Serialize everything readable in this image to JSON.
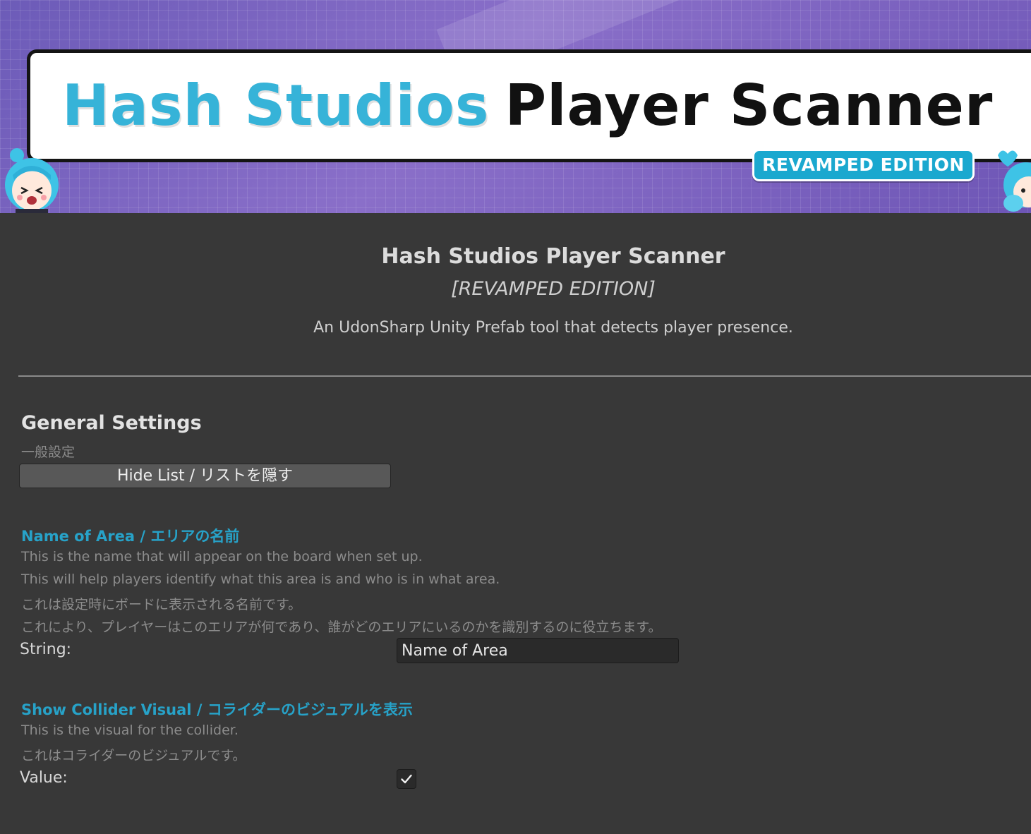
{
  "banner": {
    "title_part1": "Hash Studios",
    "title_part2": "Player Scanner",
    "edition_badge": "REVAMPED EDITION",
    "accent_color": "#36b3d8",
    "background_color": "#7a63c2"
  },
  "header": {
    "title": "Hash Studios Player Scanner",
    "subtitle": "[REVAMPED EDITION]",
    "description": "An UdonSharp Unity Prefab tool that detects player presence."
  },
  "general_settings": {
    "title": "General Settings",
    "subtitle_jp": "一般設定",
    "toggle_button_label": "Hide List / リストを隠す"
  },
  "name_of_area": {
    "label": "Name of Area / エリアの名前",
    "help": [
      "This is the name that will appear on the board when set up.",
      "This will help players identify what this area is and who is in what area.",
      "これは設定時にボードに表示される名前です。",
      "これにより、プレイヤーはこのエリアが何であり、誰がどのエリアにいるのかを識別するのに役立ちます。"
    ],
    "field_label": "String:",
    "value": "Name of Area"
  },
  "show_collider_visual": {
    "label": "Show Collider Visual / コライダーのビジュアルを表示",
    "help": [
      "This is the visual for the collider.",
      "これはコライダーのビジュアルです。"
    ],
    "field_label": "Value:",
    "checked": true,
    "check_icon": "checkmark-icon"
  }
}
